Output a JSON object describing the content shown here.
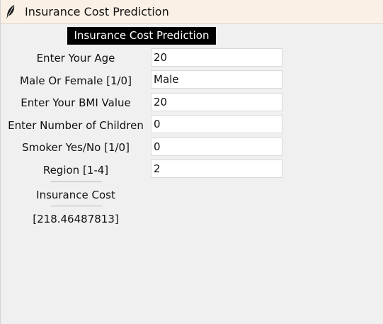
{
  "window": {
    "title": "Insurance Cost Prediction",
    "icon": "feather-icon"
  },
  "form": {
    "heading": "Insurance Cost Prediction",
    "fields": [
      {
        "label": "Enter Your Age",
        "value": "20"
      },
      {
        "label": "Male Or Female [1/0]",
        "value": "Male"
      },
      {
        "label": "Enter Your BMI Value",
        "value": "20"
      },
      {
        "label": "Enter Number of Children",
        "value": "0"
      },
      {
        "label": "Smoker Yes/No [1/0]",
        "value": "0"
      },
      {
        "label": "Region [1-4]",
        "value": "2"
      }
    ],
    "button_label": "Insurance Cost",
    "result": "[218.46487813]"
  },
  "colors": {
    "background": "#f0f0f0",
    "titlebar": "#fbf0e6",
    "heading_bg": "#000000",
    "heading_fg": "#ffffff"
  }
}
